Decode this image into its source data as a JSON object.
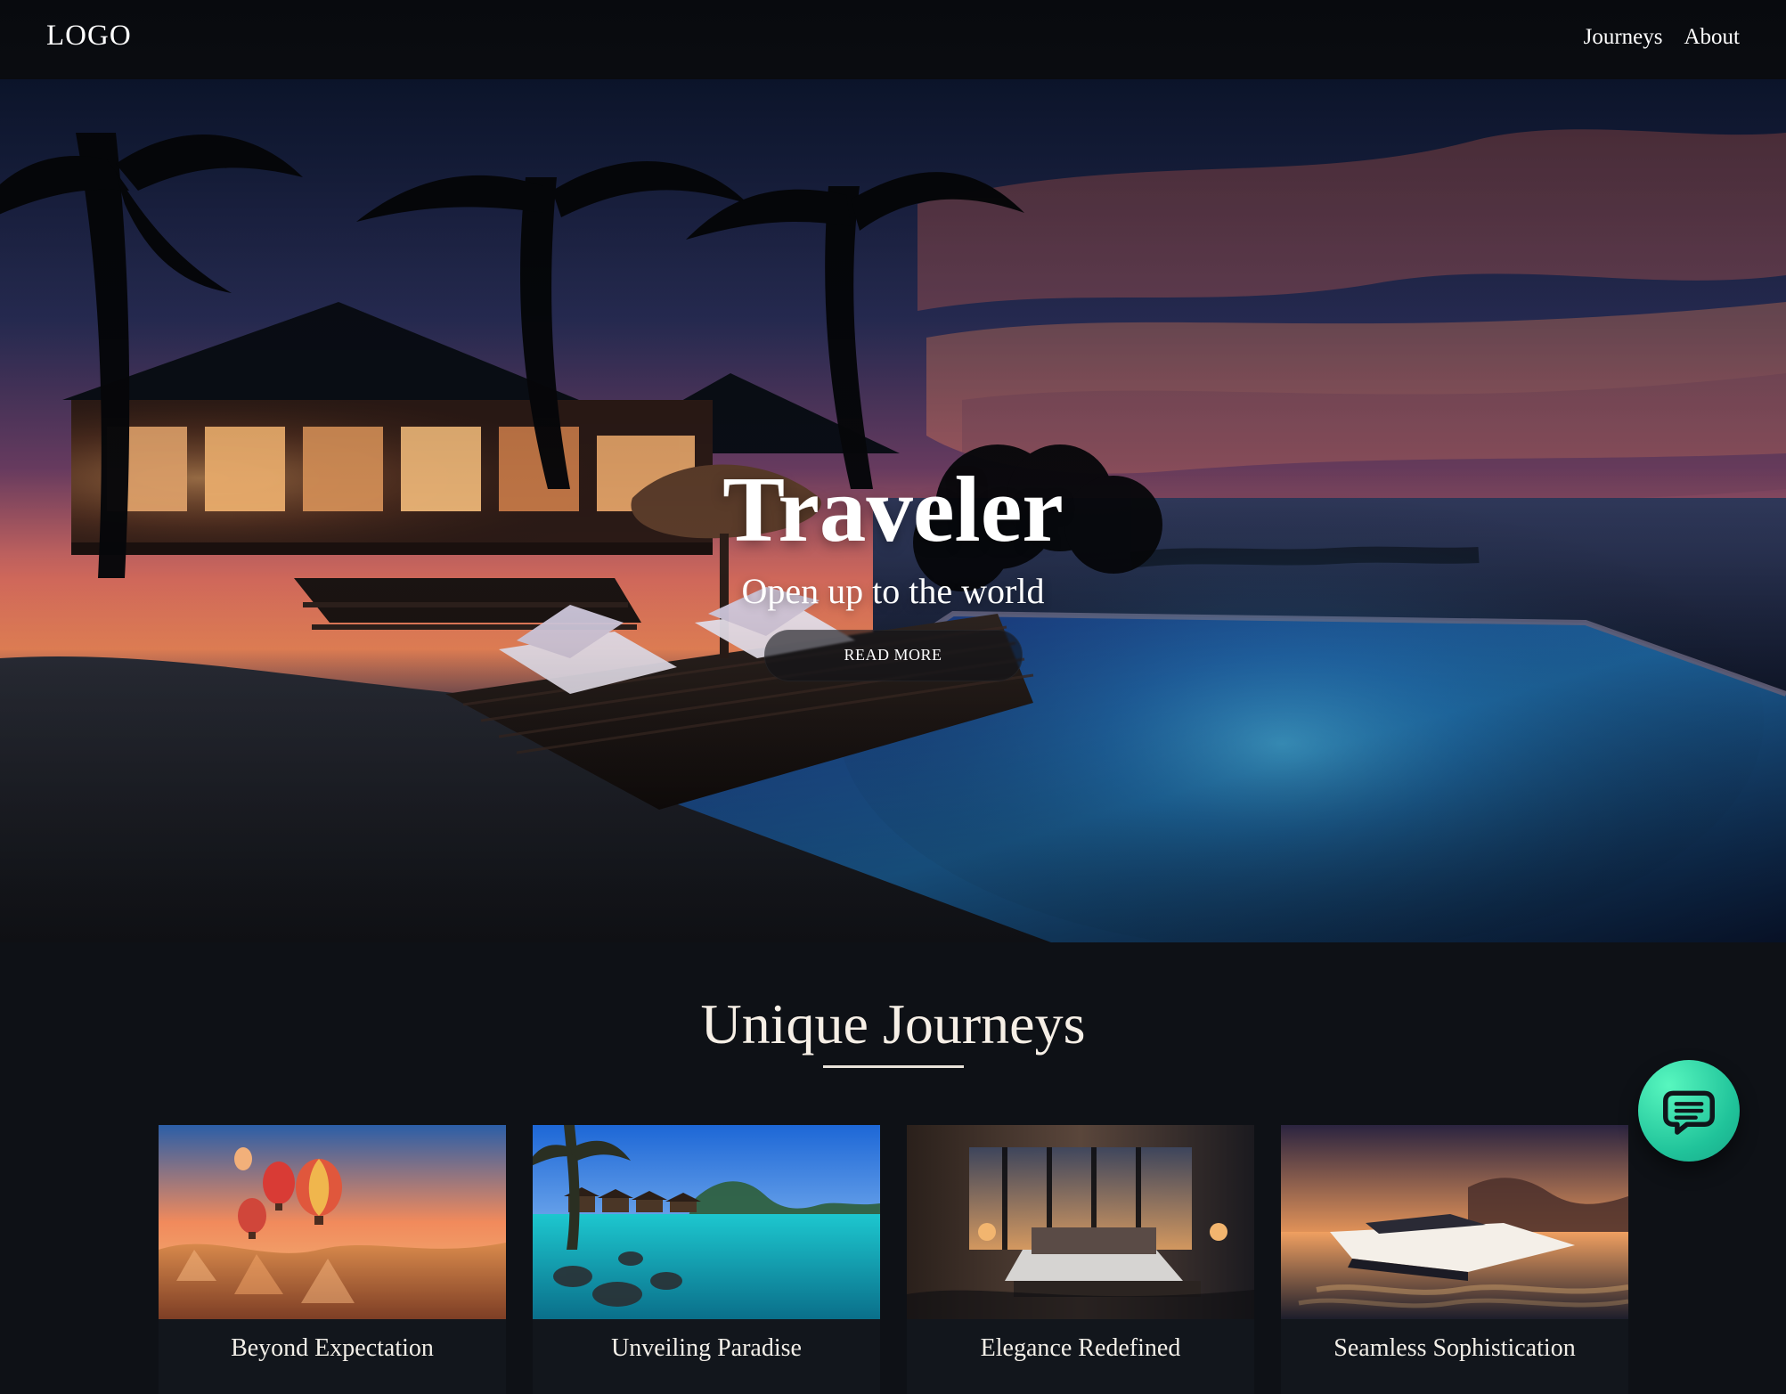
{
  "header": {
    "logo": "LOGO",
    "nav": [
      {
        "label": "Journeys"
      },
      {
        "label": "About"
      }
    ]
  },
  "hero": {
    "title": "Traveler",
    "subtitle": "Open up to the world",
    "cta_label": "READ MORE"
  },
  "section": {
    "title": "Unique Journeys"
  },
  "cards": [
    {
      "title": "Beyond Expectation"
    },
    {
      "title": "Unveiling Paradise"
    },
    {
      "title": "Elegance Redefined"
    },
    {
      "title": "Seamless Sophistication"
    }
  ],
  "colors": {
    "accent_chat": "#20c39a",
    "bg_dark": "#0e1116"
  },
  "icons": {
    "chat": "chat-icon"
  }
}
